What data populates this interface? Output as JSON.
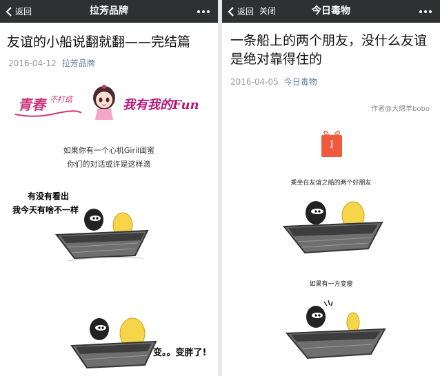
{
  "left": {
    "nav": {
      "back_label": "返回",
      "title": "拉芳品牌"
    },
    "article": {
      "title": "友谊的小船说翻就翻——完结篇",
      "date": "2016-04-12",
      "account": "拉芳品牌"
    },
    "banner": {
      "left_text": "青春",
      "left_small": "不打结",
      "right_text": "我有我的Fun"
    },
    "caption_lines": [
      "如果你有一个心机Giril闺蜜",
      "你们的对话或许是这样滴"
    ],
    "comic": {
      "bubble_1": "有没有看出",
      "bubble_2": "我今天有啥不一样",
      "bubble_3": "变。。变胖了!"
    }
  },
  "right": {
    "nav": {
      "back_label": "返回",
      "close_label": "关闭",
      "title": "今日毒物"
    },
    "article": {
      "title": "一条船上的两个朋友，没什么友谊是绝对靠得住的",
      "date": "2016-04-05",
      "account": "今日毒物"
    },
    "author_credit": "作者@大绵羊bobo",
    "gift_letter": "I",
    "comic": {
      "caption_1": "乘坐在友谊之船的两个好朋友",
      "caption_2": "如果有一方变瘦"
    }
  },
  "colors": {
    "navbar": "#2e3132",
    "account_link": "#607fa6",
    "meta": "#999999",
    "banner_pink": "#d0367a",
    "gift_red": "#ef5a3c"
  }
}
